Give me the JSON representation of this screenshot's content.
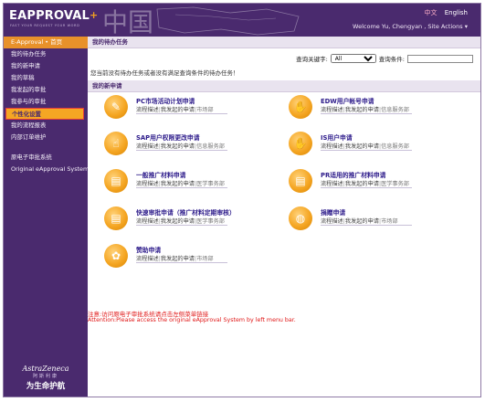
{
  "header": {
    "logo": "EAPPROVAL",
    "logo_plus": "+",
    "tagline": "FAST YOUR REQUEST YOUR WORD",
    "lang_zh": "中文",
    "lang_en": "English",
    "welcome": "Welcome Yu, Chengyan , Site Actions ▾"
  },
  "sidebar": {
    "head": "E-Approval • 首页",
    "items": [
      {
        "label": "我的待办任务"
      },
      {
        "label": "我的新申请"
      },
      {
        "label": "我的草稿"
      },
      {
        "label": "我发起的审批"
      },
      {
        "label": "我参与的审批"
      },
      {
        "label": "个性化设置"
      },
      {
        "label": "我的流程报表"
      },
      {
        "label": "内部订单维护"
      }
    ],
    "links": [
      {
        "label": "原电子审批系统"
      },
      {
        "label": "Original eApproval System"
      }
    ],
    "footer": {
      "brand": "AstraZeneca",
      "cn_small": "阿斯利康",
      "cn_big": "为生命护航"
    }
  },
  "main": {
    "tasks_header": "我的待办任务",
    "search": {
      "keyword_label": "查询关键字:",
      "keyword_value": "All",
      "condition_label": "查询条件:",
      "condition_value": ""
    },
    "notice": "您当前没有待办任务或者没有满足查询条件的待办任务！",
    "new_header": "我的新申请",
    "apps": [
      {
        "title": "PC市场活动计划申请",
        "desc": "流程描述",
        "mine": "我发起的申请",
        "dept": "市场部",
        "icon": "✎"
      },
      {
        "title": "EDW用户帐号申请",
        "desc": "流程描述",
        "mine": "我发起的申请",
        "dept": "信息服务部",
        "icon": "✋"
      },
      {
        "title": "SAP用户权限更改申请",
        "desc": "流程描述",
        "mine": "我发起的申请",
        "dept": "信息服务部",
        "icon": "☝"
      },
      {
        "title": "IS用户申请",
        "desc": "流程描述",
        "mine": "我发起的申请",
        "dept": "信息服务部",
        "icon": "✋"
      },
      {
        "title": "一般推广材料申请",
        "desc": "流程描述",
        "mine": "我发起的申请",
        "dept": "医学事务部",
        "icon": "▤"
      },
      {
        "title": "PR适用的推广材料申请",
        "desc": "流程描述",
        "mine": "我发起的申请",
        "dept": "医学事务部",
        "icon": "▤"
      },
      {
        "title": "快速审批申请（推广材料定期审核）",
        "desc": "流程描述",
        "mine": "我发起的申请",
        "dept": "医学事务部",
        "icon": "▤"
      },
      {
        "title": "捐赠申请",
        "desc": "流程描述",
        "mine": "我发起的申请",
        "dept": "市场部",
        "icon": "◍"
      },
      {
        "title": "赞助申请",
        "desc": "流程描述",
        "mine": "我发起的申请",
        "dept": "市场部",
        "icon": "✿"
      }
    ],
    "warning_cn": "注意:访问原电子审批系统请点击左侧菜单链接",
    "warning_en": "Attention:Please access the original eApproval System by left menu bar."
  },
  "colors": {
    "brand_purple": "#4a2a6e",
    "accent_orange": "#f5a623",
    "warning_red": "#e01818",
    "link_blue": "#2c1a8a"
  }
}
